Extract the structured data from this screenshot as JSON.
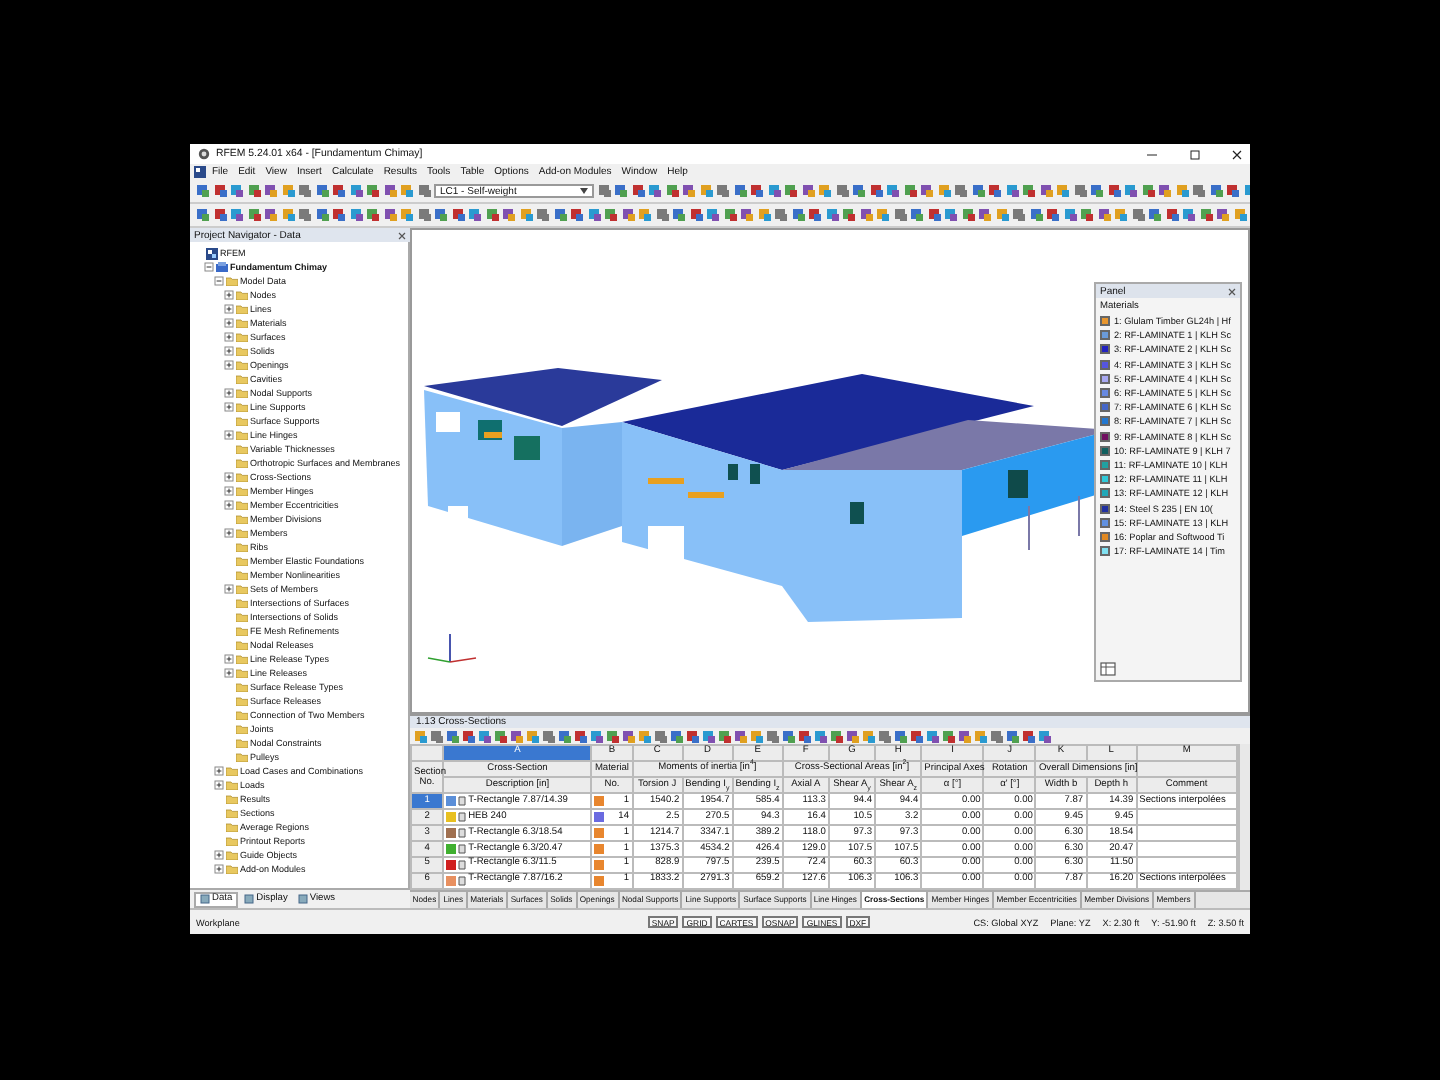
{
  "window": {
    "title": "RFEM 5.24.01 x64 - [Fundamentum Chimay]"
  },
  "menu": [
    "File",
    "Edit",
    "View",
    "Insert",
    "Calculate",
    "Results",
    "Tools",
    "Table",
    "Options",
    "Add-on Modules",
    "Window",
    "Help"
  ],
  "toolbar": {
    "load_case": "LC1 - Self-weight"
  },
  "navigator": {
    "title": "Project Navigator - Data",
    "tree": [
      {
        "label": "RFEM",
        "kind": "root",
        "children": [
          {
            "label": "Fundamentum Chimay",
            "kind": "project",
            "expanded": true,
            "children": [
              {
                "label": "Model Data",
                "expanded": true,
                "children": [
                  {
                    "label": "Nodes",
                    "expanded": false
                  },
                  {
                    "label": "Lines",
                    "expanded": false
                  },
                  {
                    "label": "Materials",
                    "expanded": false
                  },
                  {
                    "label": "Surfaces",
                    "expanded": false
                  },
                  {
                    "label": "Solids",
                    "expanded": false
                  },
                  {
                    "label": "Openings",
                    "expanded": false
                  },
                  {
                    "label": "Cavities"
                  },
                  {
                    "label": "Nodal Supports",
                    "expanded": false
                  },
                  {
                    "label": "Line Supports",
                    "expanded": false
                  },
                  {
                    "label": "Surface Supports"
                  },
                  {
                    "label": "Line Hinges",
                    "expanded": false
                  },
                  {
                    "label": "Variable Thicknesses"
                  },
                  {
                    "label": "Orthotropic Surfaces and Membranes"
                  },
                  {
                    "label": "Cross-Sections",
                    "expanded": false
                  },
                  {
                    "label": "Member Hinges",
                    "expanded": false
                  },
                  {
                    "label": "Member Eccentricities",
                    "expanded": false
                  },
                  {
                    "label": "Member Divisions"
                  },
                  {
                    "label": "Members",
                    "expanded": false
                  },
                  {
                    "label": "Ribs"
                  },
                  {
                    "label": "Member Elastic Foundations"
                  },
                  {
                    "label": "Member Nonlinearities"
                  },
                  {
                    "label": "Sets of Members",
                    "expanded": false
                  },
                  {
                    "label": "Intersections of Surfaces"
                  },
                  {
                    "label": "Intersections of Solids"
                  },
                  {
                    "label": "FE Mesh Refinements"
                  },
                  {
                    "label": "Nodal Releases"
                  },
                  {
                    "label": "Line Release Types",
                    "expanded": false
                  },
                  {
                    "label": "Line Releases",
                    "expanded": false
                  },
                  {
                    "label": "Surface Release Types"
                  },
                  {
                    "label": "Surface Releases"
                  },
                  {
                    "label": "Connection of Two Members"
                  },
                  {
                    "label": "Joints"
                  },
                  {
                    "label": "Nodal Constraints"
                  },
                  {
                    "label": "Pulleys"
                  }
                ]
              },
              {
                "label": "Load Cases and Combinations",
                "expanded": false
              },
              {
                "label": "Loads",
                "expanded": false
              },
              {
                "label": "Results"
              },
              {
                "label": "Sections"
              },
              {
                "label": "Average Regions"
              },
              {
                "label": "Printout Reports"
              },
              {
                "label": "Guide Objects",
                "expanded": false
              },
              {
                "label": "Add-on Modules",
                "expanded": false
              }
            ]
          }
        ]
      }
    ],
    "tabs": [
      {
        "label": "Data",
        "selected": true
      },
      {
        "label": "Display",
        "selected": false
      },
      {
        "label": "Views",
        "selected": false
      }
    ]
  },
  "panel": {
    "title": "Panel",
    "section": "Materials",
    "items": [
      {
        "label": "1: Glulam Timber GL24h | Hf",
        "color": "#e8962e"
      },
      {
        "label": "2: RF-LAMINATE 1 | KLH Sc",
        "color": "#6a9ad8"
      },
      {
        "label": "3: RF-LAMINATE 2 | KLH Sc",
        "color": "#2222c0"
      },
      {
        "label": "4: RF-LAMINATE 3 | KLH Sc",
        "color": "#5555e0"
      },
      {
        "label": "5: RF-LAMINATE 4 | KLH Sc",
        "color": "#a8a8f0"
      },
      {
        "label": "6: RF-LAMINATE 5 | KLH Sc",
        "color": "#6688e0"
      },
      {
        "label": "7: RF-LAMINATE 6 | KLH Sc",
        "color": "#4466c8"
      },
      {
        "label": "8: RF-LAMINATE 7 | KLH Sc",
        "color": "#2277d0"
      },
      {
        "label": "9: RF-LAMINATE 8 | KLH Sc",
        "color": "#701060"
      },
      {
        "label": "10: RF-LAMINATE 9 | KLH 7",
        "color": "#106060"
      },
      {
        "label": "11: RF-LAMINATE 10 | KLH",
        "color": "#20a0a0"
      },
      {
        "label": "12: RF-LAMINATE 11 | KLH",
        "color": "#30c8d8"
      },
      {
        "label": "13: RF-LAMINATE 12 | KLH",
        "color": "#20a8b8"
      },
      {
        "label": "14: Steel S 235 | EN 10(",
        "color": "#2030a0"
      },
      {
        "label": "15: RF-LAMINATE 13 | KLH",
        "color": "#6090e0"
      },
      {
        "label": "16: Poplar and Softwood Ti",
        "color": "#e08820"
      },
      {
        "label": "17: RF-LAMINATE 14 | Tim",
        "color": "#80e0f0"
      }
    ]
  },
  "table": {
    "title": "1.13 Cross-Sections",
    "letters": [
      "A",
      "B",
      "C",
      "D",
      "E",
      "F",
      "G",
      "H",
      "I",
      "J",
      "K",
      "L",
      "M"
    ],
    "header_groups": [
      {
        "label": "Section No."
      },
      {
        "label": "Cross-Section",
        "columns": [
          "Description [in]"
        ]
      },
      {
        "label": "Material",
        "columns": [
          "No."
        ]
      },
      {
        "label": "Moments of inertia [in$^{4}$]",
        "columns": [
          "Torsion J",
          "Bending I$_{y}$",
          "Bending I$_{z}$"
        ]
      },
      {
        "label": "Cross-Sectional Areas [in$^{2}$]",
        "columns": [
          "Axial A",
          "Shear A$_{y}$",
          "Shear A$_{z}$"
        ]
      },
      {
        "label": "Principal Axes",
        "columns": [
          "α [°]"
        ]
      },
      {
        "label": "Rotation",
        "columns": [
          "α' [°]"
        ]
      },
      {
        "label": "Overall Dimensions [in]",
        "columns": [
          "Width b",
          "Depth h"
        ]
      },
      {
        "columns": [
          "Comment"
        ]
      }
    ],
    "rows": [
      {
        "no": "1",
        "selected": true,
        "color": "#5b8fd8",
        "material": {
          "no": "1",
          "color": "#e8862e"
        },
        "cells": [
          "T-Rectangle 7.87/14.39",
          "1540.2",
          "1954.7",
          "585.4",
          "113.3",
          "94.4",
          "94.4",
          "0.00",
          "0.00",
          "7.87",
          "14.39",
          "Sections interpolées"
        ]
      },
      {
        "no": "2",
        "selected": false,
        "color": "#e8c020",
        "material": {
          "no": "14",
          "color": "#6a6ae0"
        },
        "cells": [
          "HEB 240",
          "2.5",
          "270.5",
          "94.3",
          "16.4",
          "10.5",
          "3.2",
          "0.00",
          "0.00",
          "9.45",
          "9.45",
          ""
        ]
      },
      {
        "no": "3",
        "selected": false,
        "color": "#a07050",
        "material": {
          "no": "1",
          "color": "#e8862e"
        },
        "cells": [
          "T-Rectangle 6.3/18.54",
          "1214.7",
          "3347.1",
          "389.2",
          "118.0",
          "97.3",
          "97.3",
          "0.00",
          "0.00",
          "6.30",
          "18.54",
          ""
        ]
      },
      {
        "no": "4",
        "selected": false,
        "color": "#40b030",
        "material": {
          "no": "1",
          "color": "#e8862e"
        },
        "cells": [
          "T-Rectangle 6.3/20.47",
          "1375.3",
          "4534.2",
          "426.4",
          "129.0",
          "107.5",
          "107.5",
          "0.00",
          "0.00",
          "6.30",
          "20.47",
          ""
        ]
      },
      {
        "no": "5",
        "selected": false,
        "color": "#d02020",
        "material": {
          "no": "1",
          "color": "#e8862e"
        },
        "cells": [
          "T-Rectangle 6.3/11.5",
          "828.9",
          "797.5",
          "239.5",
          "72.4",
          "60.3",
          "60.3",
          "0.00",
          "0.00",
          "6.30",
          "11.50",
          ""
        ]
      },
      {
        "no": "6",
        "selected": false,
        "color": "#e89060",
        "material": {
          "no": "1",
          "color": "#e8862e"
        },
        "cells": [
          "T-Rectangle 7.87/16.2",
          "1833.2",
          "2791.3",
          "659.2",
          "127.6",
          "106.3",
          "106.3",
          "0.00",
          "0.00",
          "7.87",
          "16.20",
          "Sections interpolées"
        ]
      }
    ],
    "tabs": [
      {
        "label": "Nodes",
        "selected": false
      },
      {
        "label": "Lines",
        "selected": false
      },
      {
        "label": "Materials",
        "selected": false
      },
      {
        "label": "Surfaces",
        "selected": false
      },
      {
        "label": "Solids",
        "selected": false
      },
      {
        "label": "Openings",
        "selected": false
      },
      {
        "label": "Nodal Supports",
        "selected": false
      },
      {
        "label": "Line Supports",
        "selected": false
      },
      {
        "label": "Surface Supports",
        "selected": false
      },
      {
        "label": "Line Hinges",
        "selected": false
      },
      {
        "label": "Cross-Sections",
        "selected": true
      },
      {
        "label": "Member Hinges",
        "selected": false
      },
      {
        "label": "Member Eccentricities",
        "selected": false
      },
      {
        "label": "Member Divisions",
        "selected": false
      },
      {
        "label": "Members",
        "selected": false
      }
    ]
  },
  "status_bar": {
    "left": "Workplane",
    "toggles": [
      "SNAP",
      "GRID",
      "CARTES",
      "OSNAP",
      "GLINES",
      "DXF"
    ],
    "readouts": [
      "CS: Global XYZ",
      "Plane: YZ",
      "X: 2.30 ft",
      "Y: -51.90 ft",
      "Z: 3.50 ft"
    ]
  }
}
